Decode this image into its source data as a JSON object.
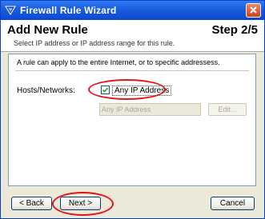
{
  "window": {
    "title": "Firewall Rule Wizard"
  },
  "header": {
    "heading": "Add New Rule",
    "step": "Step 2/5",
    "subheading": "Select IP address or IP address range for this rule."
  },
  "panel": {
    "description": "A rule can apply to the entire Internet, or to specific addressess.",
    "hosts_label": "Hosts/Networks:",
    "any_ip_label": "Any IP Address",
    "any_ip_checked": true,
    "ip_field_value": "Any IP Address",
    "edit_label": "Edit..."
  },
  "buttons": {
    "back": "< Back",
    "next": "Next >",
    "cancel": "Cancel"
  },
  "colors": {
    "annotation": "#e0141e",
    "titlebar": "#0c48cf"
  }
}
